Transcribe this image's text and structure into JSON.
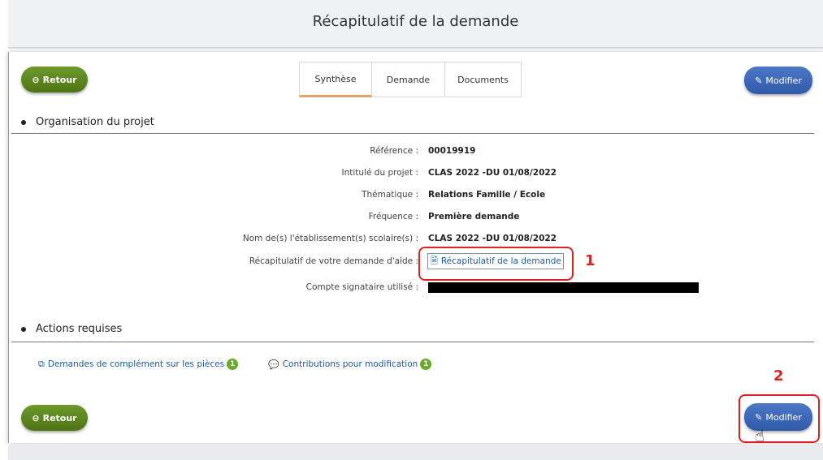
{
  "header": {
    "title": "Récapitulatif de la demande"
  },
  "buttons": {
    "back_label": "Retour",
    "modify_label": "Modifier"
  },
  "tabs": [
    {
      "label": "Synthèse",
      "active": true
    },
    {
      "label": "Demande",
      "active": false
    },
    {
      "label": "Documents",
      "active": false
    }
  ],
  "organisation": {
    "title": "Organisation du projet",
    "rows": [
      {
        "label": "Référence :",
        "value": "00019919"
      },
      {
        "label": "Intitulé du projet :",
        "value": "CLAS 2022 -DU 01/08/2022"
      },
      {
        "label": "Thématique :",
        "value": "Relations Famille / Ecole"
      },
      {
        "label": "Fréquence :",
        "value": "Première demande"
      },
      {
        "label": "Nom de(s) l'établissement(s) scolaire(s) :",
        "value": "CLAS 2022 -DU 01/08/2022"
      },
      {
        "label": "Récapitulatif de votre demande d'aide :",
        "link": "Récapitulatif de la demande"
      },
      {
        "label": "Compte signataire utilisé :",
        "value": ""
      }
    ]
  },
  "actions": {
    "title": "Actions requises",
    "links": [
      {
        "label": "Demandes de complément sur les pièces",
        "count": "1"
      },
      {
        "label": "Contributions pour modification",
        "count": "1"
      }
    ]
  },
  "annotations": {
    "one": "1",
    "two": "2"
  },
  "colors": {
    "accent_red": "#e02020",
    "green_button": "#5a8420",
    "blue_button": "#3a65b5",
    "link": "#1a5a9e"
  }
}
